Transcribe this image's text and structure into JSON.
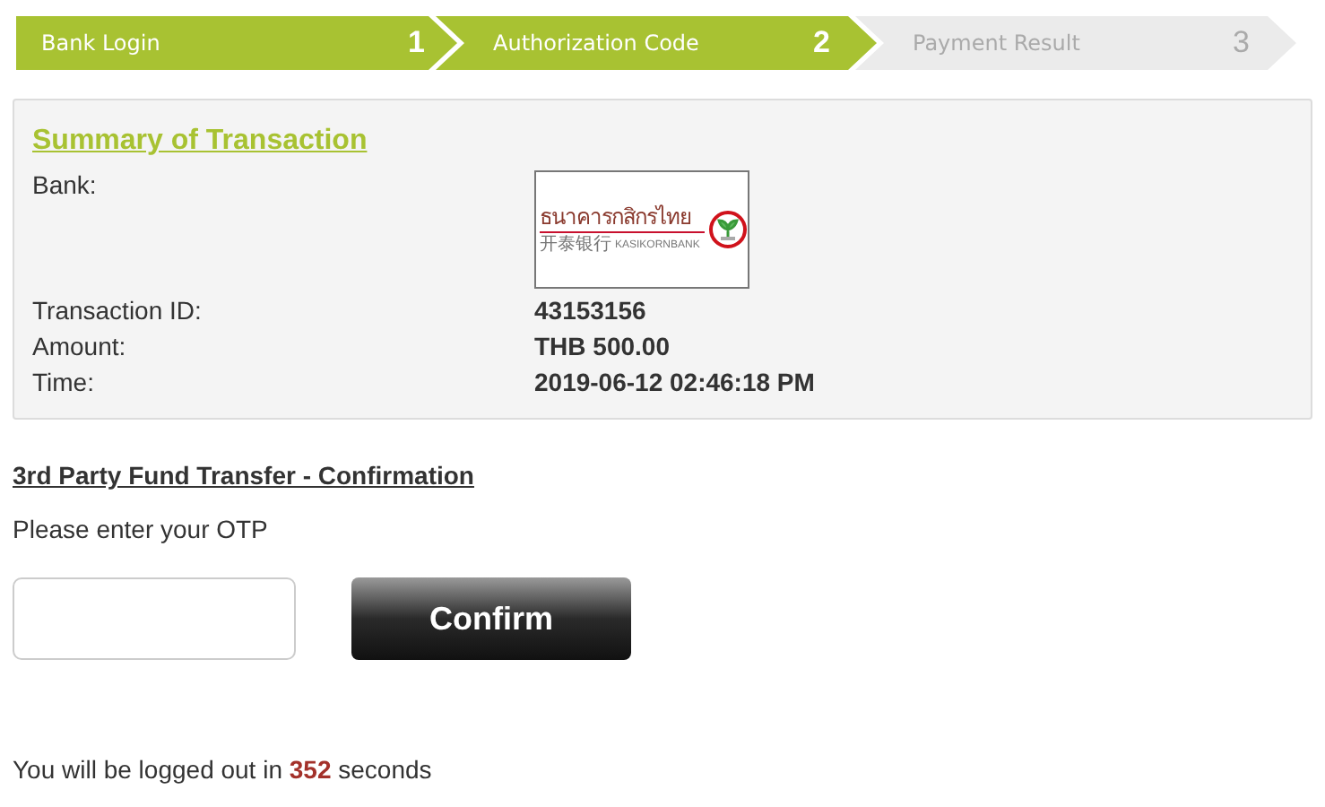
{
  "steps": [
    {
      "label": "Bank Login",
      "number": "1",
      "completed": true
    },
    {
      "label": "Authorization Code",
      "number": "2",
      "completed": true
    },
    {
      "label": "Payment Result",
      "number": "3",
      "completed": false
    }
  ],
  "summary": {
    "title": "Summary of Transaction",
    "bank_label": "Bank:",
    "bank_logo": {
      "thai_name": "ธนาคารกสิกรไทย",
      "chinese_name": "开泰银行",
      "english_name": "KASIKORNBANK"
    },
    "rows": [
      {
        "label": "Transaction ID:",
        "value": "43153156"
      },
      {
        "label": "Amount:",
        "value": "THB 500.00"
      },
      {
        "label": "Time:",
        "value": "2019-06-12 02:46:18 PM"
      }
    ]
  },
  "confirmation": {
    "heading": "3rd Party Fund Transfer - Confirmation",
    "prompt": "Please enter your OTP",
    "button": "Confirm"
  },
  "logout_notice": "You will be logged out in **352** seconds"
}
